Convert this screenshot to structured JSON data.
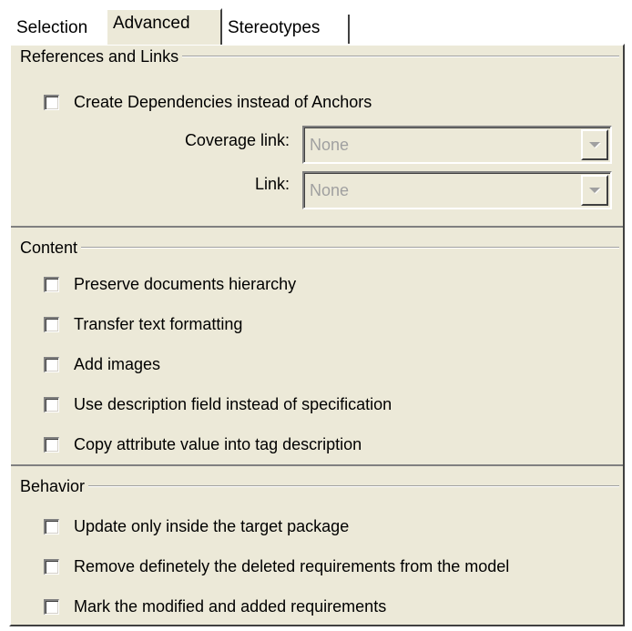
{
  "tabs": [
    {
      "label": "Selection"
    },
    {
      "label": "Advanced",
      "selected": true
    },
    {
      "label": "Stereotypes"
    }
  ],
  "references": {
    "legend": "References and Links",
    "create_dependencies": {
      "label": "Create Dependencies instead of Anchors",
      "checked": false
    },
    "coverage_link": {
      "label": "Coverage link:",
      "value": "None",
      "enabled": false
    },
    "link": {
      "label": "Link:",
      "value": "None",
      "enabled": false
    }
  },
  "content": {
    "legend": "Content",
    "options": [
      {
        "label": "Preserve documents hierarchy",
        "checked": false
      },
      {
        "label": "Transfer text formatting",
        "checked": false
      },
      {
        "label": "Add images",
        "checked": false
      },
      {
        "label": "Use description field instead of specification",
        "checked": false
      },
      {
        "label": "Copy attribute value into tag description",
        "checked": false
      }
    ]
  },
  "behavior": {
    "legend": "Behavior",
    "options": [
      {
        "label": "Update only inside the target package",
        "checked": false
      },
      {
        "label": "Remove definetely the deleted requirements from the model",
        "checked": false
      },
      {
        "label": "Mark the modified and added requirements",
        "checked": false
      }
    ]
  },
  "colors": {
    "panel": "#ece9d8",
    "disabled_text": "#a0a0a0"
  },
  "icons": {
    "dropdown": "chevron-down-icon"
  }
}
